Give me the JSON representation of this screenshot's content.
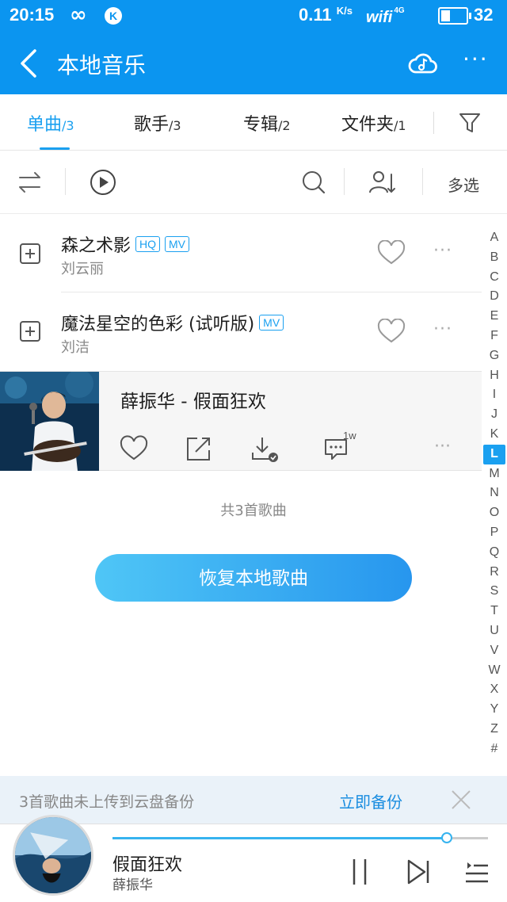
{
  "status_bar": {
    "time": "20:15",
    "speed": "0.11",
    "speed_unit": "K/s",
    "wifi": "wifi",
    "network": "4G",
    "battery": "32"
  },
  "header": {
    "title": "本地音乐"
  },
  "tabs": [
    {
      "label": "单曲",
      "count": "/3",
      "active": true
    },
    {
      "label": "歌手",
      "count": "/3",
      "active": false
    },
    {
      "label": "专辑",
      "count": "/2",
      "active": false
    },
    {
      "label": "文件夹",
      "count": "/1",
      "active": false
    }
  ],
  "toolbar": {
    "multi_select": "多选"
  },
  "songs": [
    {
      "title": "森之术影",
      "tags": [
        "HQ",
        "MV"
      ],
      "artist": "刘云丽"
    },
    {
      "title": "魔法星空的色彩 (试听版)",
      "tags": [
        "MV"
      ],
      "artist": "刘洁"
    }
  ],
  "now_playing_row": {
    "title": "薛振华 - 假面狂欢",
    "comment_count": "1w"
  },
  "list_footer": {
    "total": "共3首歌曲",
    "restore_button": "恢复本地歌曲"
  },
  "alphabet_index": {
    "letters": [
      "A",
      "B",
      "C",
      "D",
      "E",
      "F",
      "G",
      "H",
      "I",
      "J",
      "K",
      "L",
      "M",
      "N",
      "O",
      "P",
      "Q",
      "R",
      "S",
      "T",
      "U",
      "V",
      "W",
      "X",
      "Y",
      "Z",
      "#"
    ],
    "active": "L"
  },
  "backup_bar": {
    "message": "3首歌曲未上传到云盘备份",
    "action": "立即备份"
  },
  "player": {
    "title": "假面狂欢",
    "artist": "薛振华",
    "progress": 0.89
  },
  "colors": {
    "brand_blue": "#0b95f0",
    "accent": "#1aa0f0"
  }
}
